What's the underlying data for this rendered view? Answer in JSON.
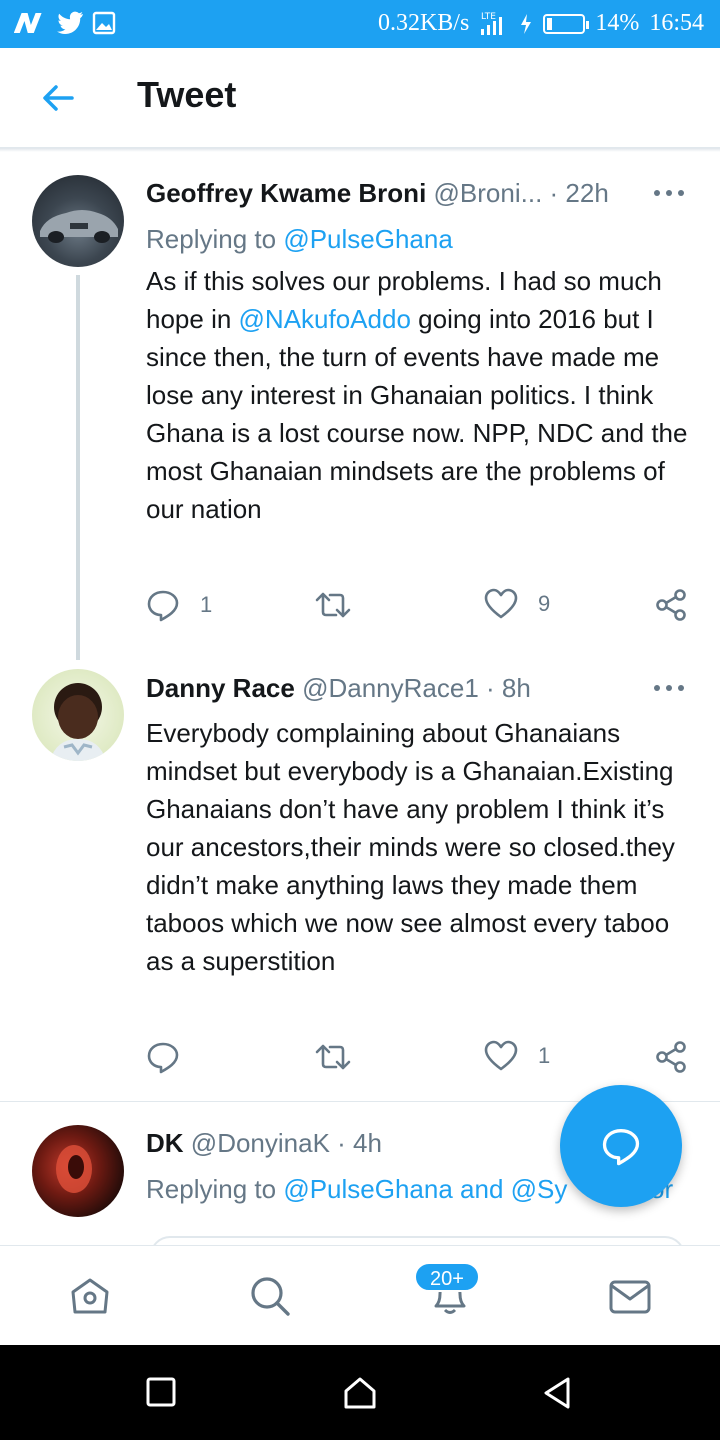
{
  "status_bar": {
    "left_icons": [
      "n-icon",
      "twitter-icon",
      "image-icon"
    ],
    "network_speed": "0.32KB/s",
    "network_type": "LTE",
    "battery": "14%",
    "time": "16:54"
  },
  "header": {
    "title": "Tweet"
  },
  "tweets": [
    {
      "name": "Geoffrey Kwame Broni",
      "handle": "@Broni...",
      "time": "· 22h",
      "reply_label": "Replying to ",
      "reply_target": "@PulseGhana",
      "text_before": "As if this solves our problems. I had so much hope in ",
      "mention": "@NAkufoAddo",
      "text_after": " going into 2016 but I since then, the turn of events have made me lose any interest in Ghanaian politics. I think Ghana is a lost course now. NPP, NDC and the most Ghanaian mindsets are the problems of our nation",
      "reply_count": "1",
      "like_count": "9"
    },
    {
      "name": "Danny Race",
      "handle": "@DannyRace1",
      "time": "· 8h",
      "text": "Everybody complaining about Ghanaians mindset but everybody is a Ghanaian.Existing Ghanaians don’t have any problem I think it’s our ancestors,their minds were so closed.they didn’t make anything laws they made them taboos which we now see almost every taboo as a superstition",
      "reply_count": "",
      "like_count": "1"
    },
    {
      "name": "DK",
      "handle": "@DonyinaK",
      "time": "· 4h",
      "reply_label": "Replying to ",
      "reply_target": "@PulseGhana and @Sy",
      "reply_tail": "or"
    }
  ],
  "bottom_nav": {
    "notifications_badge": "20+"
  },
  "colors": {
    "accent": "#1da1f2",
    "text": "#14171a",
    "muted": "#657786",
    "divider": "#e1e8ed"
  }
}
